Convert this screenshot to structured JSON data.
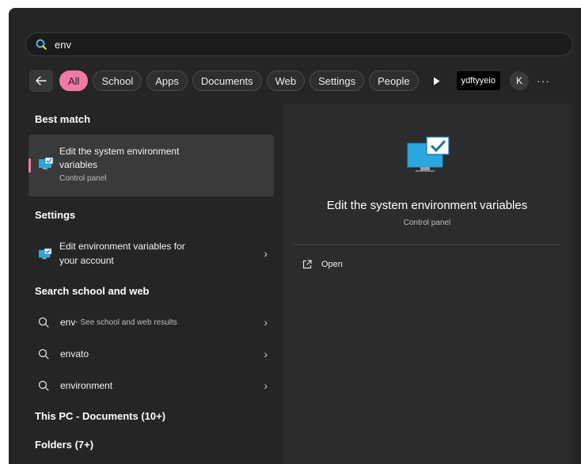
{
  "search": {
    "query": "env"
  },
  "filters": {
    "chips": [
      "All",
      "School",
      "Apps",
      "Documents",
      "Web",
      "Settings",
      "People"
    ],
    "user_label": "ydftyyeio",
    "avatar_letter": "K",
    "more": "···"
  },
  "left": {
    "best_match_title": "Best match",
    "best_match": {
      "line1": "Edit the system environment",
      "line2": "variables",
      "subtitle": "Control panel"
    },
    "settings_title": "Settings",
    "setting_item": {
      "line1": "Edit environment variables for",
      "line2": "your account"
    },
    "web_title": "Search school and web",
    "web_items": [
      {
        "label": "env",
        "hint": " - See school and web results"
      },
      {
        "label": "envato",
        "hint": ""
      },
      {
        "label": "environment",
        "hint": ""
      }
    ],
    "this_pc": "This PC - Documents (10+)",
    "folders": "Folders (7+)"
  },
  "preview": {
    "title": "Edit the system environment variables",
    "subtitle": "Control panel",
    "open_label": "Open"
  },
  "colors": {
    "accent": "#f07aa6",
    "panel_bg": "#252525",
    "card_bg": "#3a3a3a"
  }
}
